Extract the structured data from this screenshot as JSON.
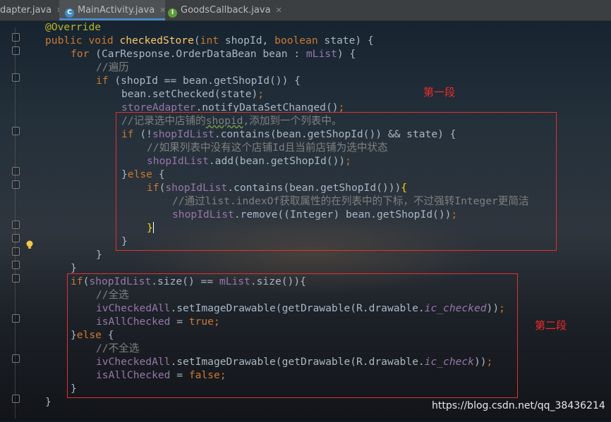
{
  "tabs": [
    {
      "label": "dapter.java",
      "icon": "none",
      "active": false
    },
    {
      "label": "MainActivity.java",
      "icon": "class-c-icon",
      "active": true
    },
    {
      "label": "GoodsCallback.java",
      "icon": "interface-i-icon",
      "active": false
    }
  ],
  "code": {
    "l1": "@Override",
    "l2a": "public void ",
    "l2b": "checkedStore",
    "l2c": "(",
    "l2d": "int ",
    "l2e": "shopId, ",
    "l2f": "boolean ",
    "l2g": "state) {",
    "l3a": "for ",
    "l3b": "(CarResponse.OrderDataBean bean : ",
    "l3c": "mList",
    "l3d": ") {",
    "l4": "//遍历",
    "l5a": "if ",
    "l5b": "(shopId == bean.getShopId()) {",
    "l6a": "bean.setChecked(state)",
    "l6b": ";",
    "l7a": "storeAdapter",
    "l7b": ".notifyDataSetChanged()",
    "l7c": ";",
    "l8a": "//记录选中店铺的",
    "l8b": "shopid",
    "l8c": ",添加到一个列表中。",
    "l9a": "if ",
    "l9b": "(!",
    "l9c": "shopIdList",
    "l9d": ".contains(bean.getShopId()) && state) {",
    "l10": "//如果列表中没有这个店铺Id且当前店铺为选中状态",
    "l11a": "shopIdList",
    "l11b": ".add(bean.getShopId())",
    "l11c": ";",
    "l12a": "}",
    "l12b": "else ",
    "l12c": "{",
    "l13a": "if",
    "l13b": "(",
    "l13c": "shopIdList",
    "l13d": ".contains(bean.getShopId()))",
    "l13e": "{",
    "l14": "//通过list.indexOf获取属性的在列表中的下标，不过强转Integer更简洁",
    "l15a": "shopIdList",
    "l15b": ".remove((Integer) bean.getShopId())",
    "l15c": ";",
    "l16": "}",
    "l17": "}",
    "l18": "}",
    "l19": "}",
    "l20a": "if",
    "l20b": "(",
    "l20c": "shopIdList",
    "l20d": ".size() == ",
    "l20e": "mList",
    "l20f": ".size()){",
    "l21": "//全选",
    "l22a": "ivCheckedAll",
    "l22b": ".setImageDrawable(getDrawable(R.drawable.",
    "l22c": "ic_checked",
    "l22d": "))",
    "l22e": ";",
    "l23a": "isAllChecked ",
    "l23b": "= ",
    "l23c": "true",
    "l23d": ";",
    "l24a": "}",
    "l24b": "else ",
    "l24c": "{",
    "l25": "//不全选",
    "l26a": "ivCheckedAll",
    "l26b": ".setImageDrawable(getDrawable(R.drawable.",
    "l26c": "ic_check",
    "l26d": "))",
    "l26e": ";",
    "l27a": "isAllChecked ",
    "l27b": "= ",
    "l27c": "false",
    "l27d": ";",
    "l28": "}",
    "l29": "}"
  },
  "annotations": {
    "first": "第一段",
    "second": "第二段"
  },
  "watermark": "https://blog.csdn.net/qq_38436214",
  "colors": {
    "keyword": "#cc7832",
    "field": "#9876aa",
    "method": "#ffc66d",
    "comment": "#808080",
    "annotation": "#bbb529",
    "highlight_box": "#e23131"
  }
}
